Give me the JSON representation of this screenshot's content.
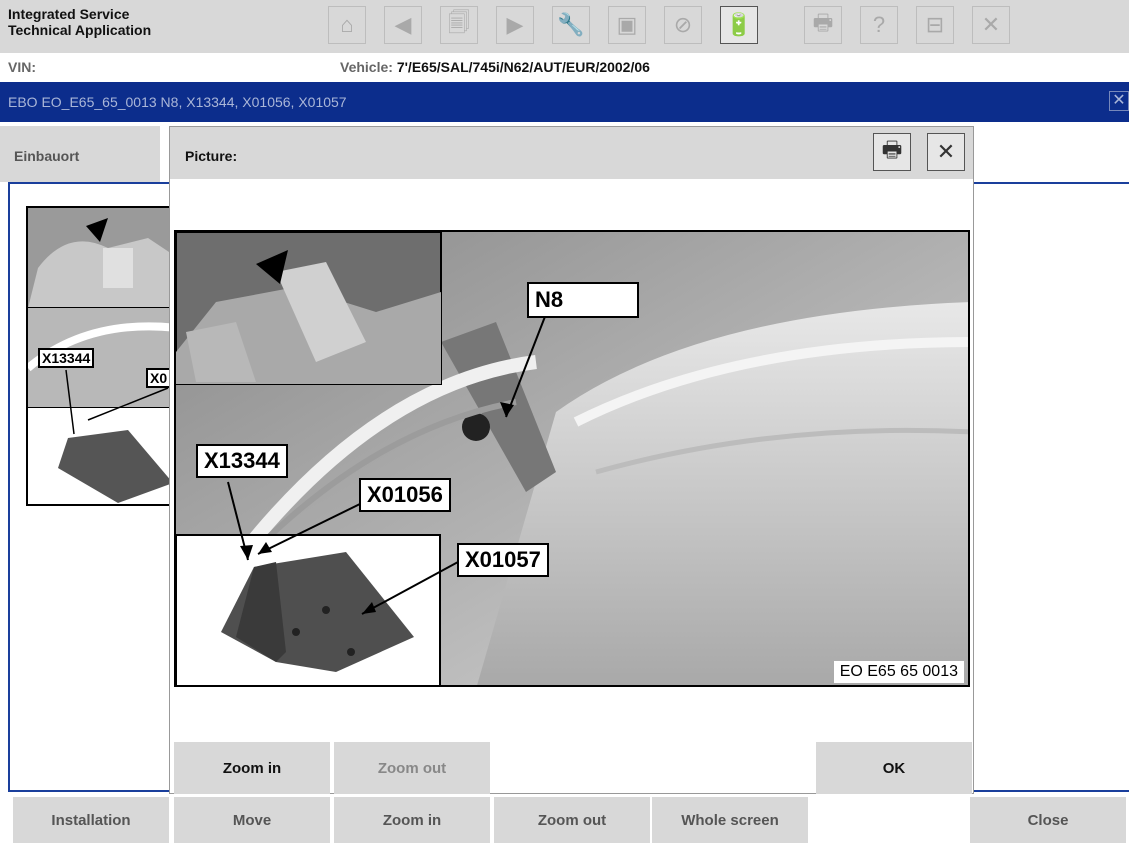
{
  "app": {
    "title": "Integrated Service\nTechnical Application"
  },
  "toolbar": {
    "buttons": [
      {
        "name": "home-icon",
        "glyph": "⌂",
        "active": false
      },
      {
        "name": "back-icon",
        "glyph": "◀",
        "active": false
      },
      {
        "name": "documents-icon",
        "glyph": "🗐",
        "active": false
      },
      {
        "name": "forward-icon",
        "glyph": "▶",
        "active": false
      },
      {
        "name": "wrench-icon",
        "glyph": "🔧",
        "active": false
      },
      {
        "name": "compare-icon",
        "glyph": "▣",
        "active": false
      },
      {
        "name": "connector-icon",
        "glyph": "⊘",
        "active": false
      },
      {
        "name": "battery-icon",
        "glyph": "🔋",
        "active": true
      },
      {
        "name": "print-icon",
        "glyph": "🖶",
        "active": false
      },
      {
        "name": "help-icon",
        "glyph": "?",
        "active": false
      },
      {
        "name": "minimize-icon",
        "glyph": "⊟",
        "active": false
      },
      {
        "name": "close-icon",
        "glyph": "✕",
        "active": false
      }
    ]
  },
  "vehicle": {
    "vin_label": "VIN:",
    "vehicle_label": "Vehicle: ",
    "vehicle_value": "7'/E65/SAL/745i/N62/AUT/EUR/2002/06"
  },
  "ebo": {
    "title": "EBO EO_E65_65_0013 N8, X13344, X01056, X01057",
    "close_glyph": "✕"
  },
  "tabs": {
    "einbauort": "Einbauort"
  },
  "background_thumbnail": {
    "labels": [
      "X13344",
      "X0"
    ]
  },
  "bottom_bar": {
    "installation": "Installation",
    "move": "Move",
    "zoom_in": "Zoom in",
    "zoom_out": "Zoom out",
    "whole_screen": "Whole screen",
    "close": "Close"
  },
  "dialog": {
    "title": "Picture:",
    "print_glyph": "🖶",
    "close_glyph": "✕",
    "callouts": {
      "n8": "N8",
      "x13344": "X13344",
      "x01056": "X01056",
      "x01057": "X01057"
    },
    "figure_code": "EO E65 65 0013",
    "buttons": {
      "zoom_in": "Zoom in",
      "zoom_out": "Zoom out",
      "ok": "OK"
    }
  },
  "colors": {
    "header_bg": "#d8d8d8",
    "ebo_bar": "#0c2d8c",
    "frame_border": "#1a3f9c",
    "disabled_text": "#999999"
  }
}
